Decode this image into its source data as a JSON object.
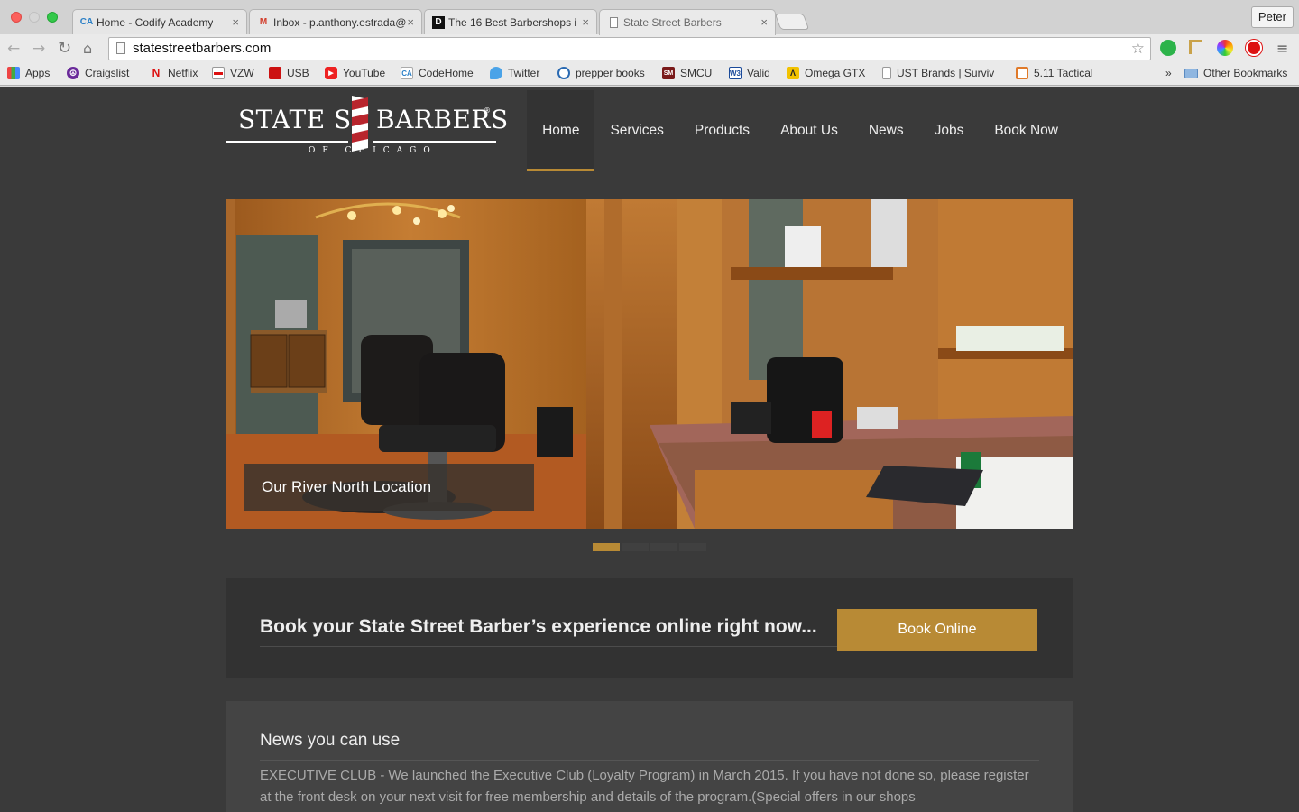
{
  "browser": {
    "tabs": [
      {
        "favicon": "codify-favicon",
        "label": "Home - Codify Academy"
      },
      {
        "favicon": "gmail-icon",
        "label": "Inbox - p.anthony.estrada@"
      },
      {
        "favicon": "dmagazine-icon",
        "label": "The 16 Best Barbershops i"
      },
      {
        "favicon": "page-icon",
        "label": "State Street Barbers"
      }
    ],
    "profile_name": "Peter",
    "url": "statestreetbarbers.com",
    "bookmarks": [
      {
        "icon": "apps-icon",
        "label": "Apps"
      },
      {
        "icon": "peace-icon",
        "label": "Craigslist"
      },
      {
        "icon": "netflix-icon",
        "label": "Netflix"
      },
      {
        "icon": "vzw-icon",
        "label": "VZW"
      },
      {
        "icon": "usb-icon",
        "label": "USB"
      },
      {
        "icon": "youtube-icon",
        "label": "YouTube"
      },
      {
        "icon": "codify-icon",
        "label": "CodeHome"
      },
      {
        "icon": "twitter-icon",
        "label": "Twitter"
      },
      {
        "icon": "globe-icon",
        "label": "prepper books"
      },
      {
        "icon": "smcu-icon",
        "label": "SMCU"
      },
      {
        "icon": "w3c-icon",
        "label": "Valid"
      },
      {
        "icon": "omega-icon",
        "label": "Omega GTX"
      },
      {
        "icon": "page-icon",
        "label": "UST Brands | Surviv"
      },
      {
        "icon": "tactical-icon",
        "label": "5.11 Tactical"
      }
    ],
    "overflow_label": "»",
    "other_bookmarks": "Other Bookmarks"
  },
  "site": {
    "logo": {
      "word1": "STATE ST",
      "word2": "BARBERS",
      "sub": "OF CHICAGO",
      "reg": "®"
    },
    "nav": [
      "Home",
      "Services",
      "Products",
      "About Us",
      "News",
      "Jobs",
      "Book Now"
    ],
    "active_nav": "Home",
    "hero_caption": "Our River North Location",
    "slider": {
      "count": 4,
      "active_index": 0
    },
    "cta_text": "Book your State Street Barber’s experience online right now...",
    "cta_button": "Book Online",
    "news_title": "News you can use",
    "news_body": "EXECUTIVE CLUB - We launched the Executive Club (Loyalty Program) in March 2015. If you have not done so, please register at the front desk on your next visit for free membership and details of the program.(Special offers in our shops"
  },
  "colors": {
    "accent": "#b88a35",
    "page_bg": "#3a3a3a"
  }
}
